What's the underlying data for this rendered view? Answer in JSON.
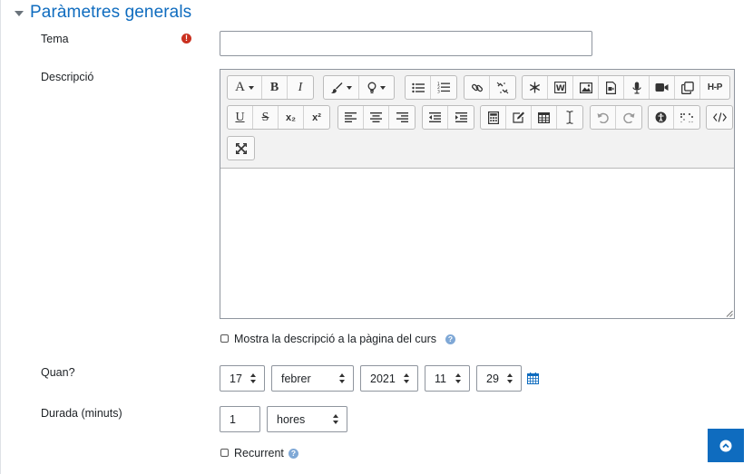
{
  "section": {
    "title": "Paràmetres generals"
  },
  "fields": {
    "topic": {
      "label": "Tema",
      "required_icon": "!",
      "value": "",
      "placeholder": ""
    },
    "description": {
      "label": "Descripció"
    },
    "show_description": {
      "label": "Mostra la descripció a la pàgina del curs",
      "checked": false,
      "help_icon": "?"
    },
    "when": {
      "label": "Quan?",
      "day": "17",
      "month": "febrer",
      "year": "2021",
      "hour": "11",
      "minute": "29",
      "icon": "calendar-icon"
    },
    "duration": {
      "label": "Durada (minuts)",
      "value": "1",
      "unit": "hores"
    },
    "recurring": {
      "label": "Recurrent",
      "checked": false,
      "help_icon": "?"
    }
  },
  "editor": {
    "toolbar_row1": [
      "font-size",
      "bold",
      "italic",
      "paint-brush",
      "lightbulb",
      "bullet-list",
      "numbered-list",
      "link",
      "unlink",
      "snowflake",
      "wiris",
      "image",
      "media",
      "record-audio",
      "record-video",
      "manage-files",
      "h5p"
    ],
    "toolbar_row2": [
      "underline",
      "strikethrough",
      "subscript",
      "superscript",
      "align-left",
      "align-center",
      "align-right",
      "outdent",
      "indent",
      "equation",
      "edit",
      "table",
      "text-cursor",
      "undo",
      "redo",
      "accessibility",
      "braille",
      "html"
    ],
    "toolbar_row3": [
      "fullscreen"
    ],
    "labels": {
      "font": "A",
      "bold": "B",
      "italic": "I",
      "underline": "U",
      "strike": "S",
      "sub": "x₂",
      "sup": "x²",
      "h5p": "H-P"
    }
  },
  "colors": {
    "accent": "#0f6cbf",
    "required": "#ca3120",
    "help": "#7fa8d6"
  }
}
